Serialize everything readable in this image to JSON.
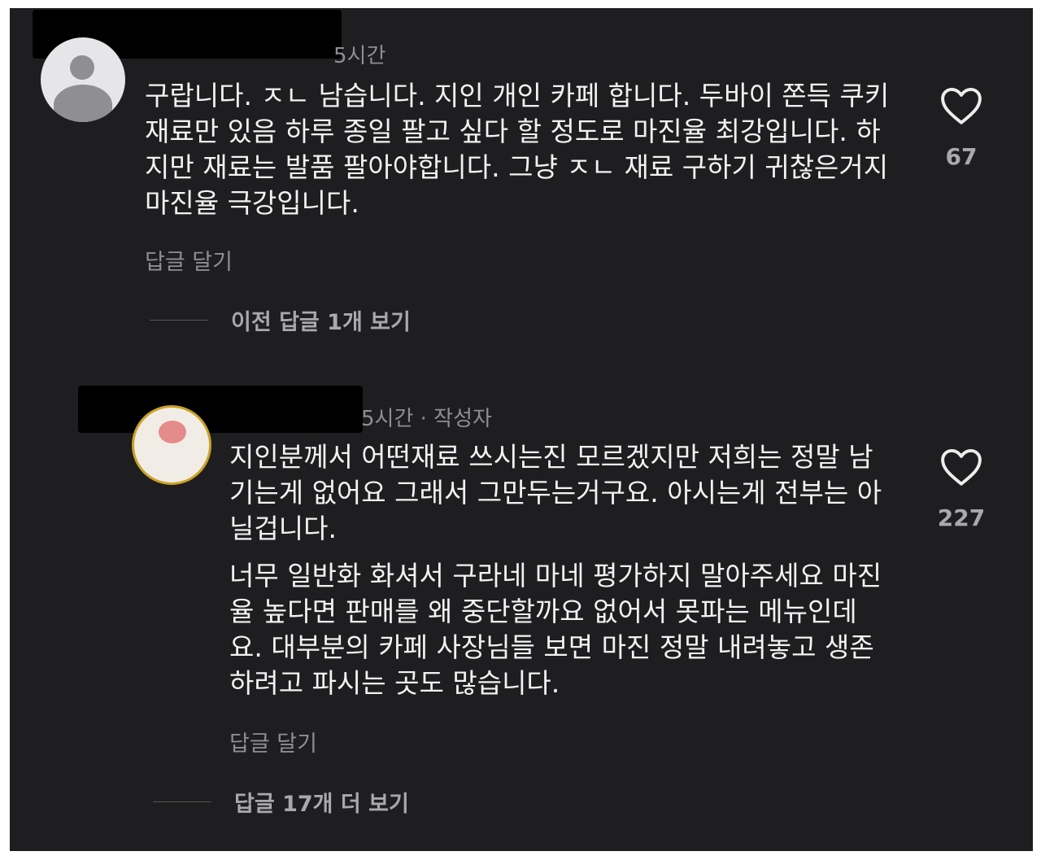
{
  "comments": [
    {
      "time": "5시간",
      "paragraphs": [
        "구랍니다. ㅈㄴ 남습니다. 지인 개인 카페 합니다. 두바이 쫀득 쿠키 재료만 있음 하루 종일 팔고 싶다 할 정도로 마진율 최강입니다. 하지만 재료는 발품 팔아야합니다. 그냥 ㅈㄴ 재료 구하기 귀찮은거지 마진율 극강입니다."
      ],
      "reply_label": "답글 달기",
      "thread_label": "이전 답글 1개 보기",
      "like_count": "67",
      "icon": "heart-outline-icon"
    },
    {
      "time": "5시간 · 작성자",
      "paragraphs": [
        "지인분께서 어떤재료 쓰시는진 모르겠지만 저희는 정말 남기는게 없어요 그래서 그만두는거구요. 아시는게 전부는 아닐겁니다.",
        "너무 일반화 화셔서 구라네 마네 평가하지 말아주세요 마진율 높다면 판매를 왜 중단할까요 없어서 못파는 메뉴인데요. 대부분의 카페 사장님들 보면 마진 정말 내려놓고 생존하려고 파시는 곳도 많습니다."
      ],
      "reply_label": "답글 달기",
      "thread_label": "답글 17개 더 보기",
      "like_count": "227",
      "icon": "heart-outline-icon"
    }
  ],
  "colors": {
    "background": "#1e1e20",
    "text": "#f2f2f2",
    "muted": "#8e8e93",
    "redaction": "#000000"
  }
}
